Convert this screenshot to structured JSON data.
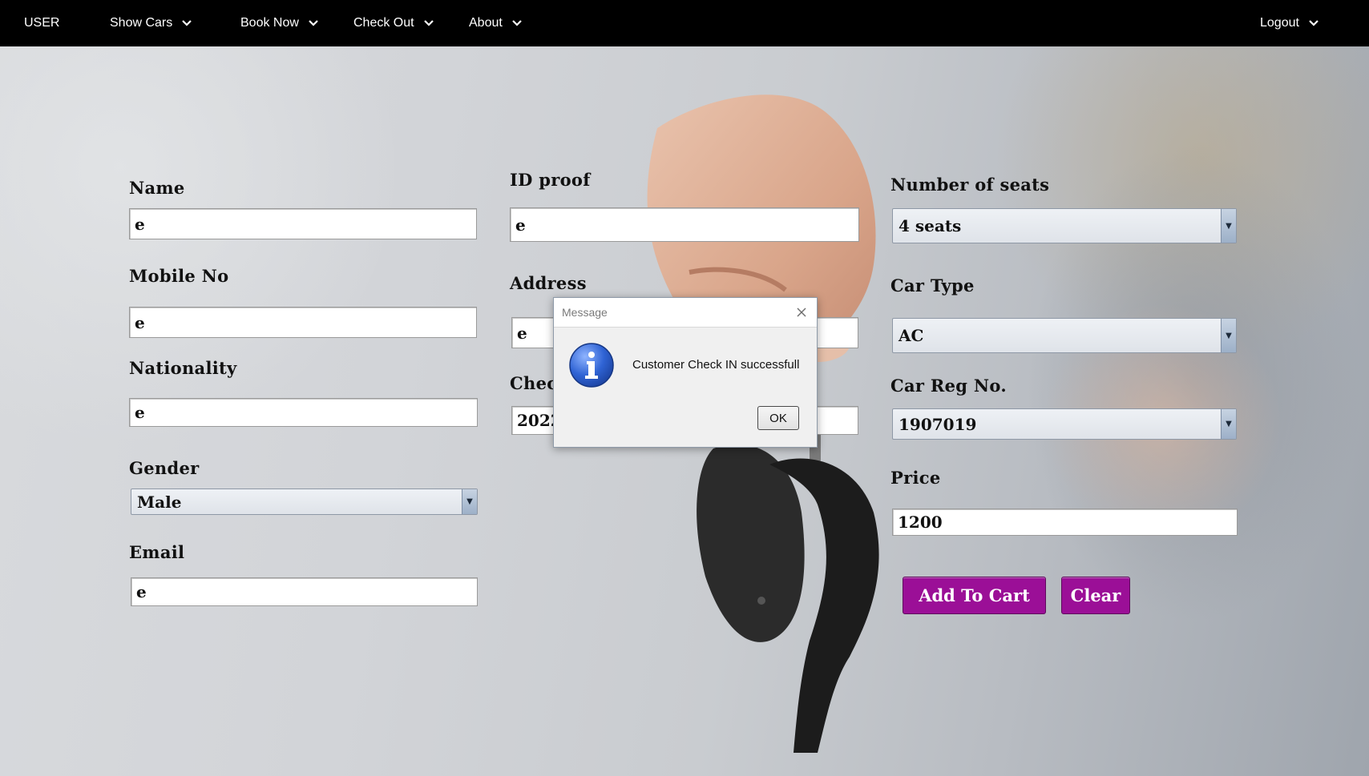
{
  "nav": {
    "brand": "USER",
    "items": [
      {
        "label": "Show Cars"
      },
      {
        "label": "Book Now"
      },
      {
        "label": "Check Out"
      },
      {
        "label": "About"
      }
    ],
    "logout": "Logout"
  },
  "form": {
    "name": {
      "label": "Name",
      "value": "e"
    },
    "mobile": {
      "label": "Mobile No",
      "value": "e"
    },
    "nationality": {
      "label": "Nationality",
      "value": "e"
    },
    "gender": {
      "label": "Gender",
      "value": "Male"
    },
    "email": {
      "label": "Email",
      "value": "e"
    },
    "id_proof": {
      "label": "ID proof",
      "value": "e"
    },
    "address": {
      "label": "Address",
      "value": "e"
    },
    "checkin": {
      "label": "Check",
      "value": "2022"
    },
    "seats": {
      "label": "Number of seats",
      "value": "4 seats"
    },
    "car_type": {
      "label": "Car Type",
      "value": "AC"
    },
    "car_reg": {
      "label": "Car Reg No.",
      "value": "1907019"
    },
    "price": {
      "label": "Price",
      "value": "1200"
    },
    "add_to_cart": "Add To Cart",
    "clear": "Clear"
  },
  "dialog": {
    "title": "Message",
    "message": "Customer Check IN successfull",
    "ok": "OK"
  },
  "colors": {
    "nav_bg": "#000000",
    "button_bg": "#9b0f97"
  }
}
